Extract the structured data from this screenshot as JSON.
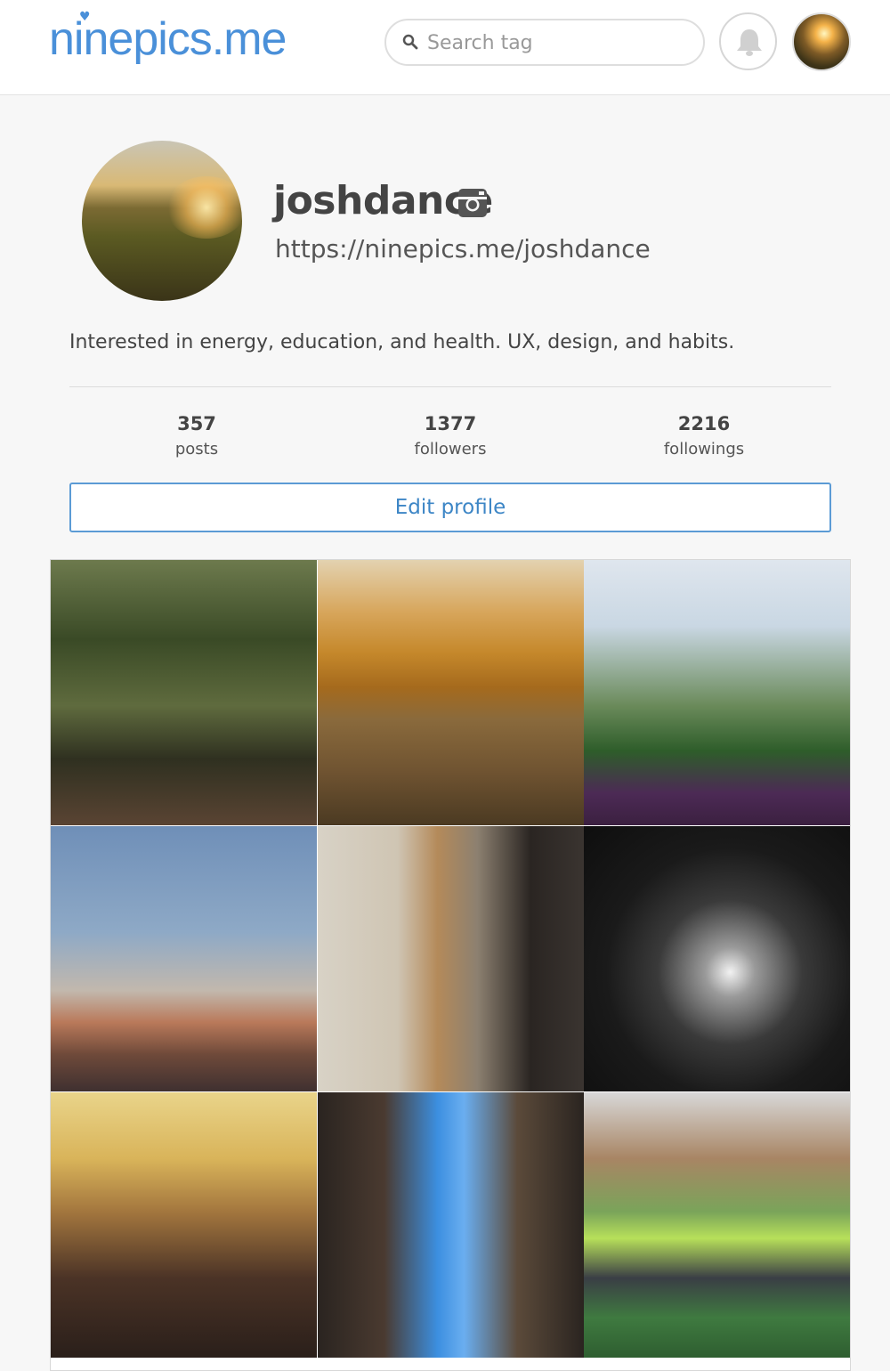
{
  "header": {
    "logo_text": "ninepics.me",
    "search_placeholder": "Search tag"
  },
  "profile": {
    "username": "joshdance",
    "url": "https://ninepics.me/joshdance",
    "bio": "Interested in energy, education, and health. UX, design, and habits.",
    "stats": [
      {
        "value": "357",
        "label": "posts"
      },
      {
        "value": "1377",
        "label": "followers"
      },
      {
        "value": "2216",
        "label": "followings"
      }
    ],
    "edit_button": "Edit profile"
  },
  "colors": {
    "accent": "#4a90d9",
    "button_border": "#5b9bd5"
  },
  "icons": [
    "search-icon",
    "bell-icon",
    "instagram-icon"
  ],
  "photos": [
    {
      "alt": "forest-boardwalk-photo"
    },
    {
      "alt": "autumn-hillside-photo"
    },
    {
      "alt": "palm-trees-temple-photo"
    },
    {
      "alt": "mountain-sunset-photo"
    },
    {
      "alt": "group-costume-photo"
    },
    {
      "alt": "tunnel-silhouette-photo"
    },
    {
      "alt": "roller-coaster-photo"
    },
    {
      "alt": "canyon-rappel-photo"
    },
    {
      "alt": "soccer-team-photo"
    }
  ]
}
